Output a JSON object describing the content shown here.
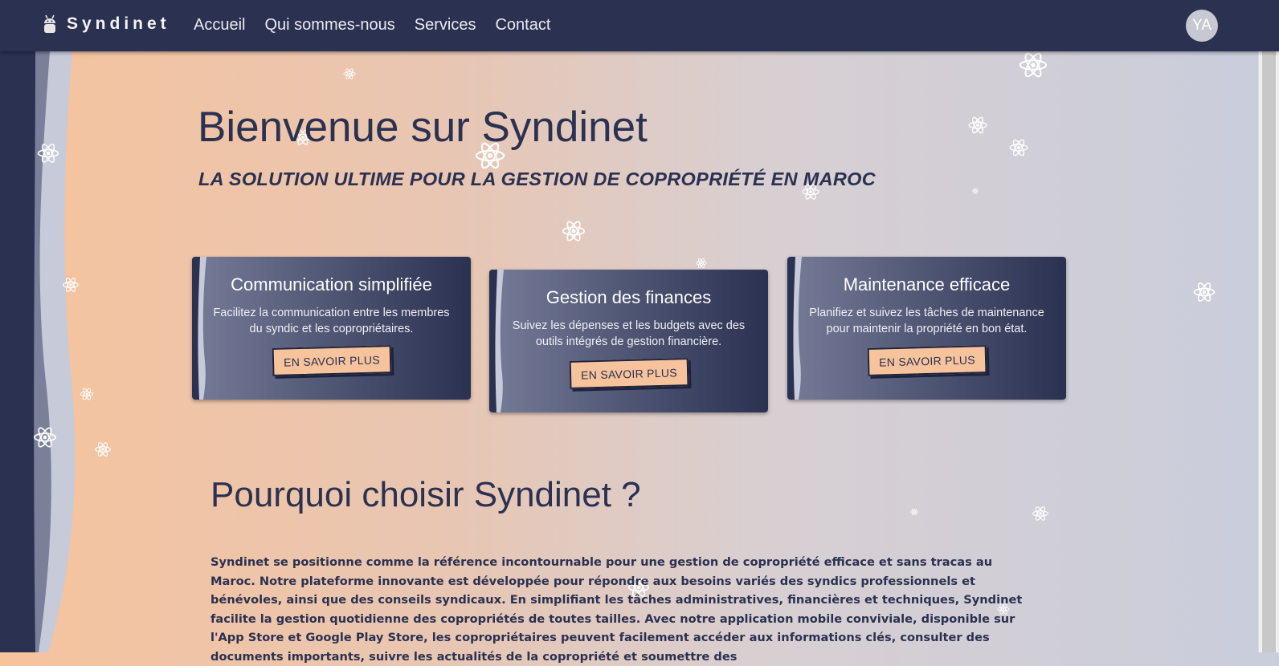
{
  "nav": {
    "brand": "Syndinet",
    "brand_icon": "android-icon",
    "links": [
      "Accueil",
      "Qui sommes-nous",
      "Services",
      "Contact"
    ],
    "avatar": "YA"
  },
  "hero": {
    "title": "Bienvenue sur Syndinet",
    "subtitle": "LA SOLUTION ULTIME POUR LA GESTION DE COPROPRIÉTÉ EN MAROC"
  },
  "cards": [
    {
      "title": "Communication simplifiée",
      "text": "Facilitez la communication entre les membres du syndic et les copropriétaires.",
      "button": "EN SAVOIR PLUS"
    },
    {
      "title": "Gestion des finances",
      "text": "Suivez les dépenses et les budgets avec des outils intégrés de gestion financière.",
      "button": "EN SAVOIR PLUS"
    },
    {
      "title": "Maintenance efficace",
      "text": "Planifiez et suivez les tâches de maintenance pour maintenir la propriété en bon état.",
      "button": "EN SAVOIR PLUS"
    }
  ],
  "why": {
    "title": "Pourquoi choisir Syndinet ?",
    "text": "Syndinet se positionne comme la référence incontournable pour une gestion de copropriété efficace et sans tracas au Maroc. Notre plateforme innovante est développée pour répondre aux besoins variés des syndics professionnels et bénévoles, ainsi que des conseils syndicaux. En simplifiant les tâches administratives, financières et techniques, Syndinet facilite la gestion quotidienne des copropriétés de toutes tailles. Avec notre application mobile conviviale, disponible sur l'App Store et Google Play Store, les copropriétaires peuvent facilement accéder aux informations clés, consulter des documents importants, suivre les actualités de la copropriété et soumettre des"
  },
  "colors": {
    "navy": "#2b3150",
    "peach": "#f6c39d",
    "lavender": "#c9cddc"
  },
  "decor_icon": "atom-icon"
}
